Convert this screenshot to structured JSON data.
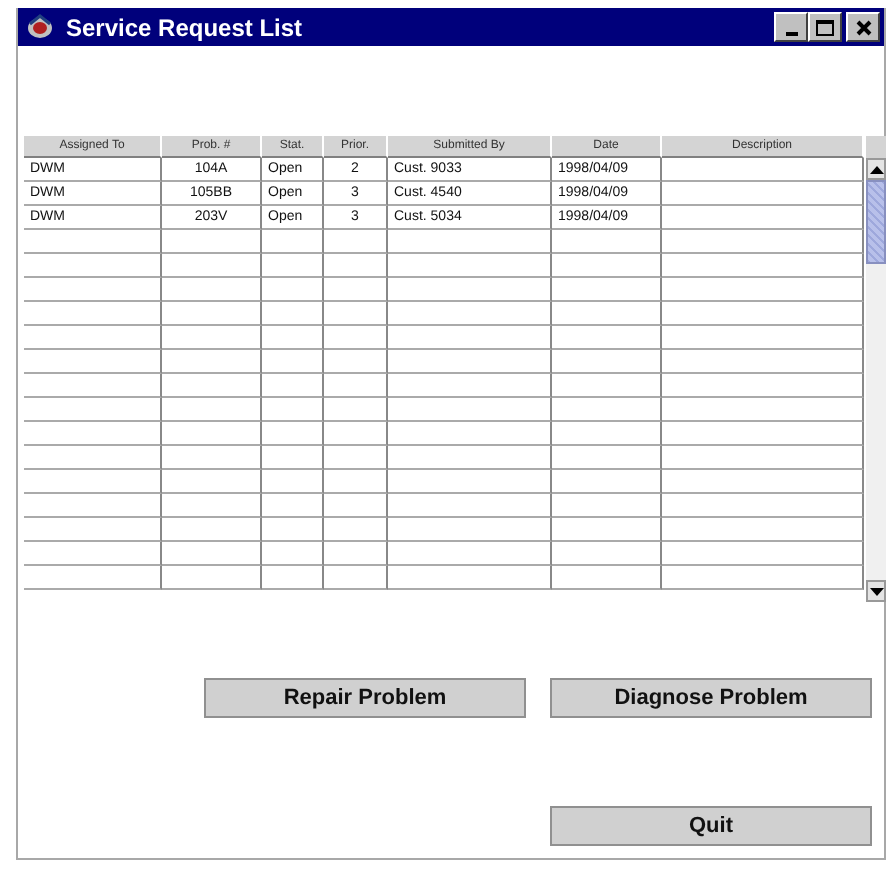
{
  "window": {
    "title": "Service Request List"
  },
  "table": {
    "columns": [
      "Assigned To",
      "Prob. #",
      "Stat.",
      "Prior.",
      "Submitted By",
      "Date",
      "Description"
    ],
    "rows": [
      [
        "DWM",
        "104A",
        "Open",
        "2",
        "Cust. 9033",
        "1998/04/09",
        ""
      ],
      [
        "DWM",
        "105BB",
        "Open",
        "3",
        "Cust. 4540",
        "1998/04/09",
        ""
      ],
      [
        "DWM",
        "203V",
        "Open",
        "3",
        "Cust. 5034",
        "1998/04/09",
        ""
      ]
    ]
  },
  "buttons": [
    "Repair Problem",
    "Diagnose Problem"
  ],
  "quit_button": "Quit"
}
